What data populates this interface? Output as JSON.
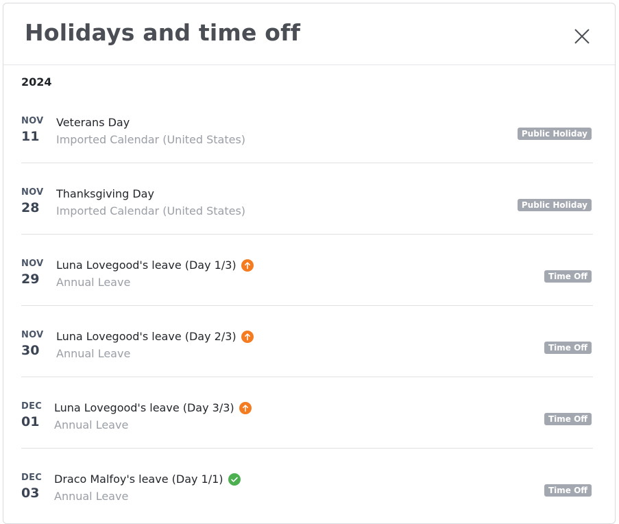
{
  "modal": {
    "title": "Holidays and time off",
    "close_icon": "close-icon"
  },
  "year": "2024",
  "events": [
    {
      "month": "NOV",
      "day": "11",
      "title": "Veterans Day",
      "subtitle": "Imported Calendar (United States)",
      "badge": "Public Holiday",
      "status_icon": null
    },
    {
      "month": "NOV",
      "day": "28",
      "title": "Thanksgiving Day",
      "subtitle": "Imported Calendar (United States)",
      "badge": "Public Holiday",
      "status_icon": null
    },
    {
      "month": "NOV",
      "day": "29",
      "title": "Luna Lovegood's leave (Day 1/3)",
      "subtitle": "Annual Leave",
      "badge": "Time Off",
      "status_icon": "pending-arrow-up-icon"
    },
    {
      "month": "NOV",
      "day": "30",
      "title": "Luna Lovegood's leave (Day 2/3)",
      "subtitle": "Annual Leave",
      "badge": "Time Off",
      "status_icon": "pending-arrow-up-icon"
    },
    {
      "month": "DEC",
      "day": "01",
      "title": "Luna Lovegood's leave (Day 3/3)",
      "subtitle": "Annual Leave",
      "badge": "Time Off",
      "status_icon": "pending-arrow-up-icon"
    },
    {
      "month": "DEC",
      "day": "03",
      "title": "Draco Malfoy's leave (Day 1/1)",
      "subtitle": "Annual Leave",
      "badge": "Time Off",
      "status_icon": "approved-check-icon"
    }
  ],
  "colors": {
    "pending": "#f47b20",
    "approved": "#4caf50",
    "badge_bg": "#a3a7b0"
  }
}
